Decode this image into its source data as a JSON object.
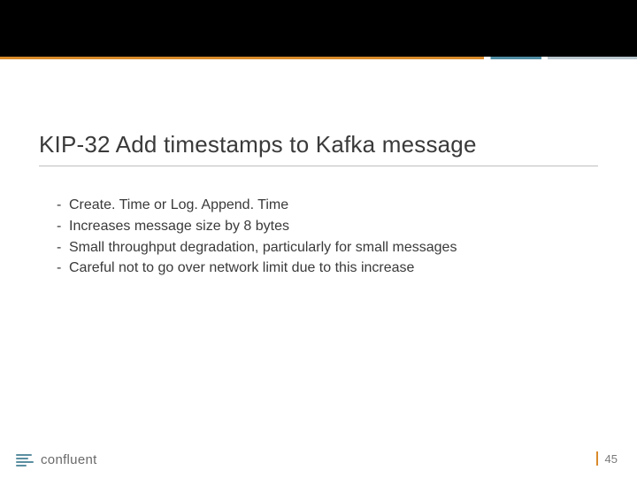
{
  "title": "KIP-32 Add timestamps to Kafka message",
  "bullets": [
    "Create. Time or Log. Append. Time",
    "Increases message size by 8 bytes",
    "Small throughput degradation, particularly for small messages",
    "Careful not to go over network limit due to this increase"
  ],
  "footer": {
    "brand": "confluent",
    "page_number": "45"
  }
}
